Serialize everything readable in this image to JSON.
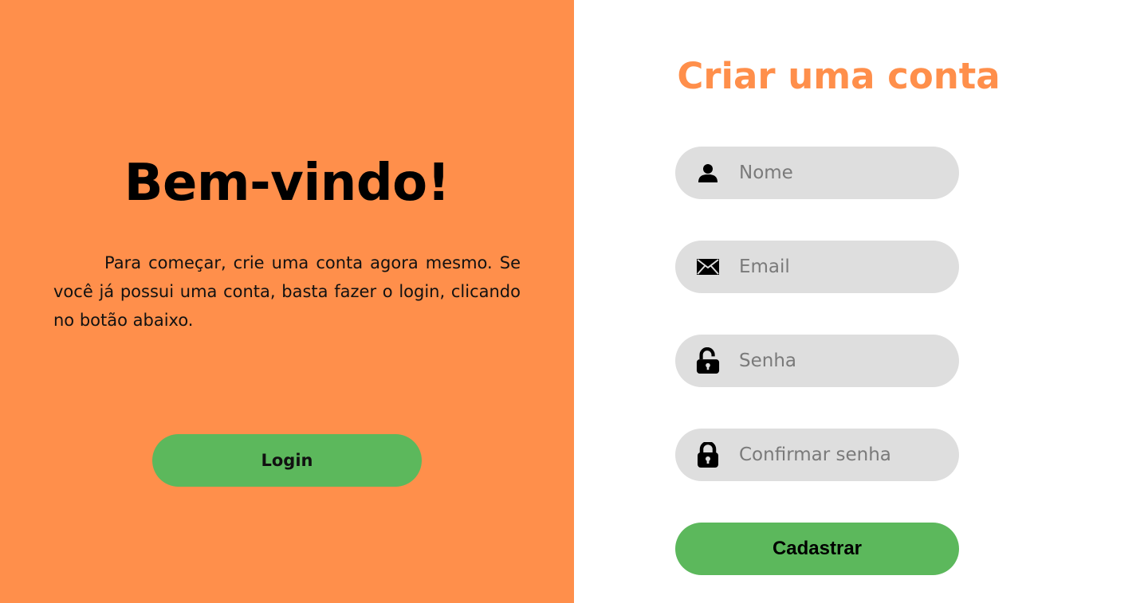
{
  "welcome": {
    "title": "Bem-vindo!",
    "text": "Para começar, crie uma conta agora mesmo. Se você já possui uma conta, basta fazer o login, clicando no botão abaixo.",
    "login_label": "Login"
  },
  "form": {
    "title": "Criar uma conta",
    "fields": [
      {
        "placeholder": "Nome",
        "icon": "user-icon",
        "value": ""
      },
      {
        "placeholder": "Email",
        "icon": "envelope-icon",
        "value": ""
      },
      {
        "placeholder": "Senha",
        "icon": "unlocked-padlock-icon",
        "value": ""
      },
      {
        "placeholder": "Confirmar senha",
        "icon": "locked-padlock-icon",
        "value": ""
      }
    ],
    "submit_label": "Cadastrar"
  },
  "colors": {
    "left_panel_bg": "#ff8f4b",
    "accent_orange": "#ff8f4b",
    "button_green": "#5cb85c",
    "input_bg": "#dedede"
  }
}
